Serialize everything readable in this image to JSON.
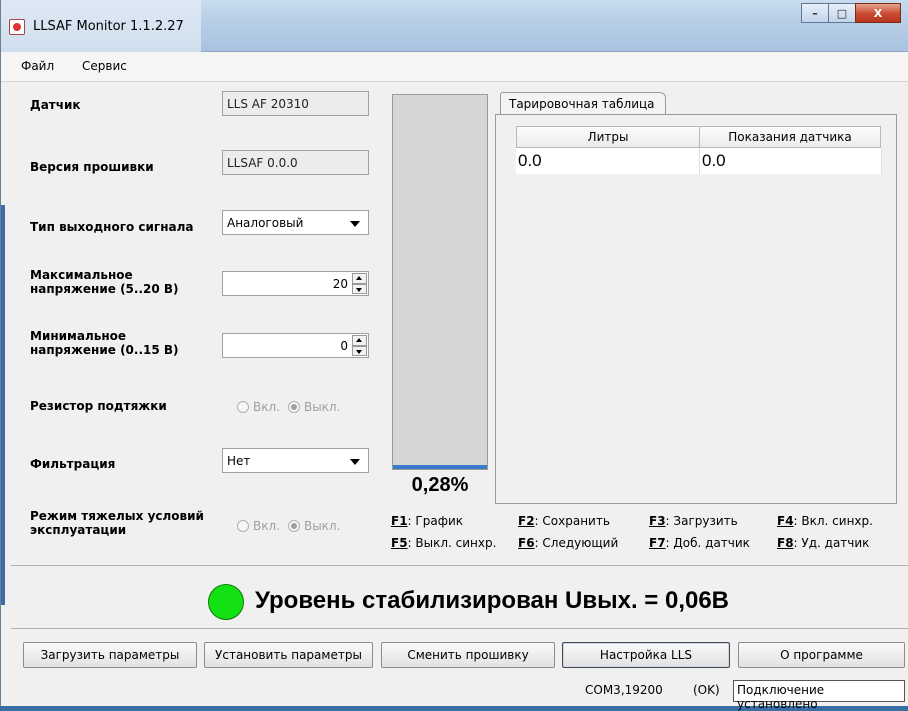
{
  "window": {
    "title": "LLSAF Monitor 1.1.2.27",
    "controls": {
      "minimize": "–",
      "maximize": "□",
      "close": "X"
    }
  },
  "menu": {
    "file": "Файл",
    "service": "Сервис"
  },
  "form": {
    "sensor_label": "Датчик",
    "sensor_value": "LLS AF 20310",
    "firmware_label": "Версия прошивки",
    "firmware_value": "LLSAF 0.0.0",
    "output_type_label": "Тип выходного сигнала",
    "output_type_value": "Аналоговый",
    "max_voltage_label": "Максимальное напряжение (5..20 В)",
    "max_voltage_value": "20",
    "min_voltage_label": "Минимальное напряжение (0..15 В)",
    "min_voltage_value": "0",
    "pullup_label": "Резистор подтяжки",
    "filter_label": "Фильтрация",
    "filter_value": "Нет",
    "heavy_mode_label": "Режим тяжелых условий эксплуатации",
    "radio_on": "Вкл.",
    "radio_off": "Выкл."
  },
  "level": {
    "percent_text": "0,28%",
    "fraction": 0.0028
  },
  "tab": {
    "label": "Тарировочная таблица",
    "columns": [
      "Литры",
      "Показания датчика"
    ],
    "rows": [
      [
        "0.0",
        "0.0"
      ]
    ]
  },
  "hotkeys": [
    {
      "key": "F1",
      "label": ": График"
    },
    {
      "key": "F2",
      "label": ": Сохранить"
    },
    {
      "key": "F3",
      "label": ": Загрузить"
    },
    {
      "key": "F4",
      "label": ": Вкл. синхр."
    },
    {
      "key": "F5",
      "label": ": Выкл. синхр."
    },
    {
      "key": "F6",
      "label": ": Следующий"
    },
    {
      "key": "F7",
      "label": ": Доб. датчик"
    },
    {
      "key": "F8",
      "label": ": Уд. датчик"
    }
  ],
  "status": {
    "text": "Уровень стабилизирован Uвых. = 0,06В",
    "led_color": "#13e113"
  },
  "buttons": {
    "load_params": "Загрузить параметры",
    "set_params": "Установить параметры",
    "change_firmware": "Сменить прошивку",
    "lls_settings": "Настройка LLS",
    "about": "О программе"
  },
  "statusbar": {
    "port": "COM3,19200",
    "ok": "(OK)",
    "connection": "Подключение установлено"
  },
  "colors": {
    "accent": "#3b78c9",
    "titlebar": "#b6cde6"
  }
}
